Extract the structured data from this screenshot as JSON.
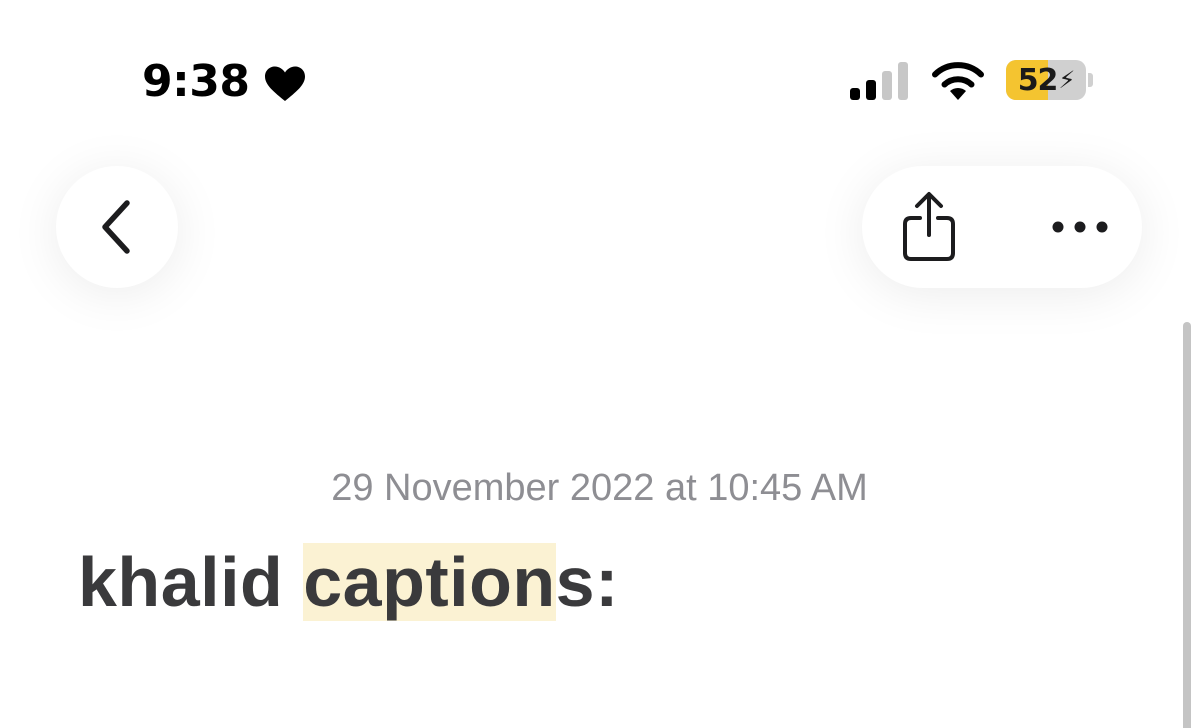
{
  "status_bar": {
    "time": "9:38",
    "battery_percent": "52",
    "battery_level": 0.52,
    "heart_icon": "heart-icon",
    "signal_icon": "cellular-signal-icon",
    "wifi_icon": "wifi-icon",
    "battery_icon": "battery-charging-icon",
    "colors": {
      "battery_fill": "#f4c430",
      "battery_track": "#d0d0d0"
    }
  },
  "navigation": {
    "back_icon": "chevron-left-icon",
    "share_icon": "share-icon",
    "more_icon": "ellipsis-icon"
  },
  "note": {
    "date": "29 November 2022 at 10:45 AM",
    "title_before": "khalid ",
    "title_highlight": "caption",
    "title_after": "s:",
    "colors": {
      "highlight": "#fbf2d3",
      "date": "#8e8e93",
      "title": "#3a3a3c"
    }
  }
}
